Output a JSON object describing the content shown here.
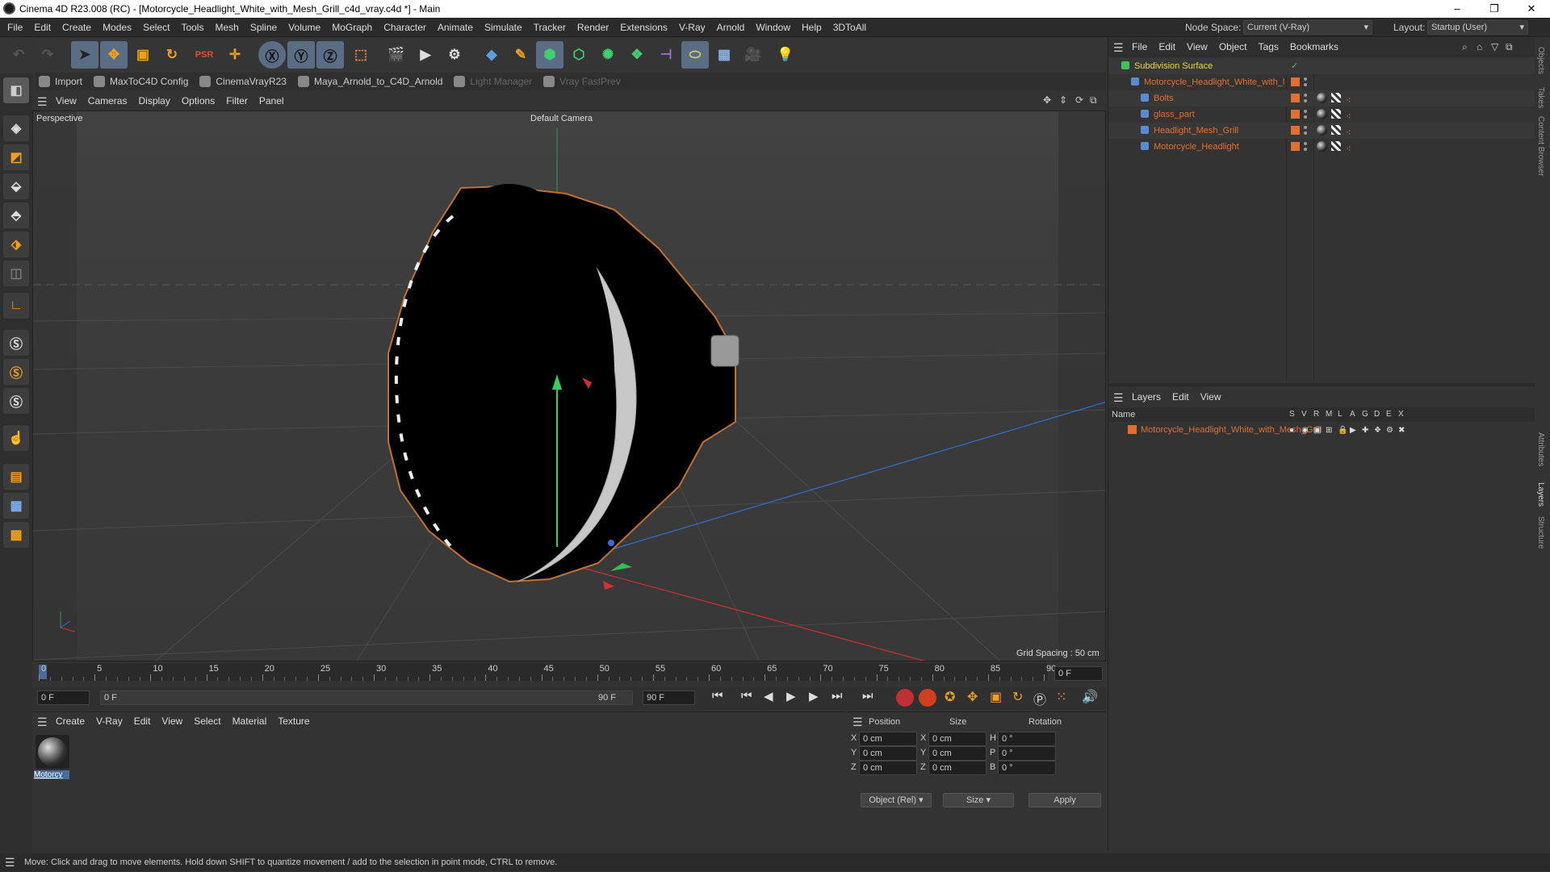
{
  "window": {
    "title": "Cinema 4D R23.008 (RC) - [Motorcycle_Headlight_White_with_Mesh_Grill_c4d_vray.c4d *] - Main",
    "controls": [
      "–",
      "❐",
      "✕"
    ]
  },
  "menubar": {
    "items": [
      "File",
      "Edit",
      "Create",
      "Modes",
      "Select",
      "Tools",
      "Mesh",
      "Spline",
      "Volume",
      "MoGraph",
      "Character",
      "Animate",
      "Simulate",
      "Tracker",
      "Render",
      "Extensions",
      "V-Ray",
      "Arnold",
      "Window",
      "Help",
      "3DToAll"
    ],
    "node_space_label": "Node Space:",
    "node_space_value": "Current (V-Ray)",
    "layout_label": "Layout:",
    "layout_value": "Startup (User)"
  },
  "plugin_bar": {
    "items": [
      {
        "label": "Import",
        "enabled": true
      },
      {
        "label": "MaxToC4D Config",
        "enabled": true
      },
      {
        "label": "CinemaVrayR23",
        "enabled": true
      },
      {
        "label": "Maya_Arnold_to_C4D_Arnold",
        "enabled": true
      },
      {
        "label": "Light Manager",
        "enabled": false
      },
      {
        "label": "Vray FastPrev",
        "enabled": false
      }
    ]
  },
  "viewport": {
    "menu": [
      "View",
      "Cameras",
      "Display",
      "Options",
      "Filter",
      "Panel"
    ],
    "view_name": "Perspective",
    "camera_label": "Default Camera",
    "grid_spacing": "Grid Spacing : 50 cm"
  },
  "timeline": {
    "ticks": [
      "0",
      "5",
      "10",
      "15",
      "20",
      "25",
      "30",
      "35",
      "40",
      "45",
      "50",
      "55",
      "60",
      "65",
      "70",
      "75",
      "80",
      "85",
      "90"
    ],
    "current_frame_right": "0 F",
    "start_field": "0 F",
    "range_start": "0 F",
    "range_end": "90 F",
    "end_field": "90 F"
  },
  "material_panel": {
    "menu": [
      "Create",
      "V-Ray",
      "Edit",
      "View",
      "Select",
      "Material",
      "Texture"
    ],
    "material_name": "Motorcy"
  },
  "coords": {
    "headers": [
      "Position",
      "Size",
      "Rotation"
    ],
    "rows": [
      {
        "axis": "X",
        "pos": "0 cm",
        "size_axis": "X",
        "size": "0 cm",
        "rot_axis": "H",
        "rot": "0 °"
      },
      {
        "axis": "Y",
        "pos": "0 cm",
        "size_axis": "Y",
        "size": "0 cm",
        "rot_axis": "P",
        "rot": "0 °"
      },
      {
        "axis": "Z",
        "pos": "0 cm",
        "size_axis": "Z",
        "size": "0 cm",
        "rot_axis": "B",
        "rot": "0 °"
      }
    ],
    "mode_select": "Object (Rel)",
    "size_select": "Size",
    "apply_label": "Apply"
  },
  "object_manager": {
    "menu": [
      "File",
      "Edit",
      "View",
      "Object",
      "Tags",
      "Bookmarks"
    ],
    "objects": [
      {
        "name": "Subdivision Surface",
        "level": 0,
        "color": "#e8d840"
      },
      {
        "name": "Motorcycle_Headlight_White_with_Mesh_Grill",
        "level": 1,
        "color": "#e07030"
      },
      {
        "name": "Bolts",
        "level": 2,
        "color": "#e07030"
      },
      {
        "name": "glass_part",
        "level": 2,
        "color": "#e07030"
      },
      {
        "name": "Headlight_Mesh_Grill",
        "level": 2,
        "color": "#e07030"
      },
      {
        "name": "Motorcycle_Headlight",
        "level": 2,
        "color": "#e07030"
      }
    ]
  },
  "layer_manager": {
    "menu": [
      "Layers",
      "Edit",
      "View"
    ],
    "col_name": "Name",
    "cols": [
      "S",
      "V",
      "R",
      "M",
      "L",
      "A",
      "G",
      "D",
      "E",
      "X"
    ],
    "layers": [
      {
        "name": "Motorcycle_Headlight_White_with_Mesh_Grill",
        "color": "#e07030"
      }
    ]
  },
  "side_tabs": [
    "Objects",
    "Takes",
    "Content Browser",
    "Attributes",
    "Layers",
    "Structure"
  ],
  "status": "Move: Click and drag to move elements. Hold down SHIFT to quantize movement / add to the selection in point mode, CTRL to remove."
}
